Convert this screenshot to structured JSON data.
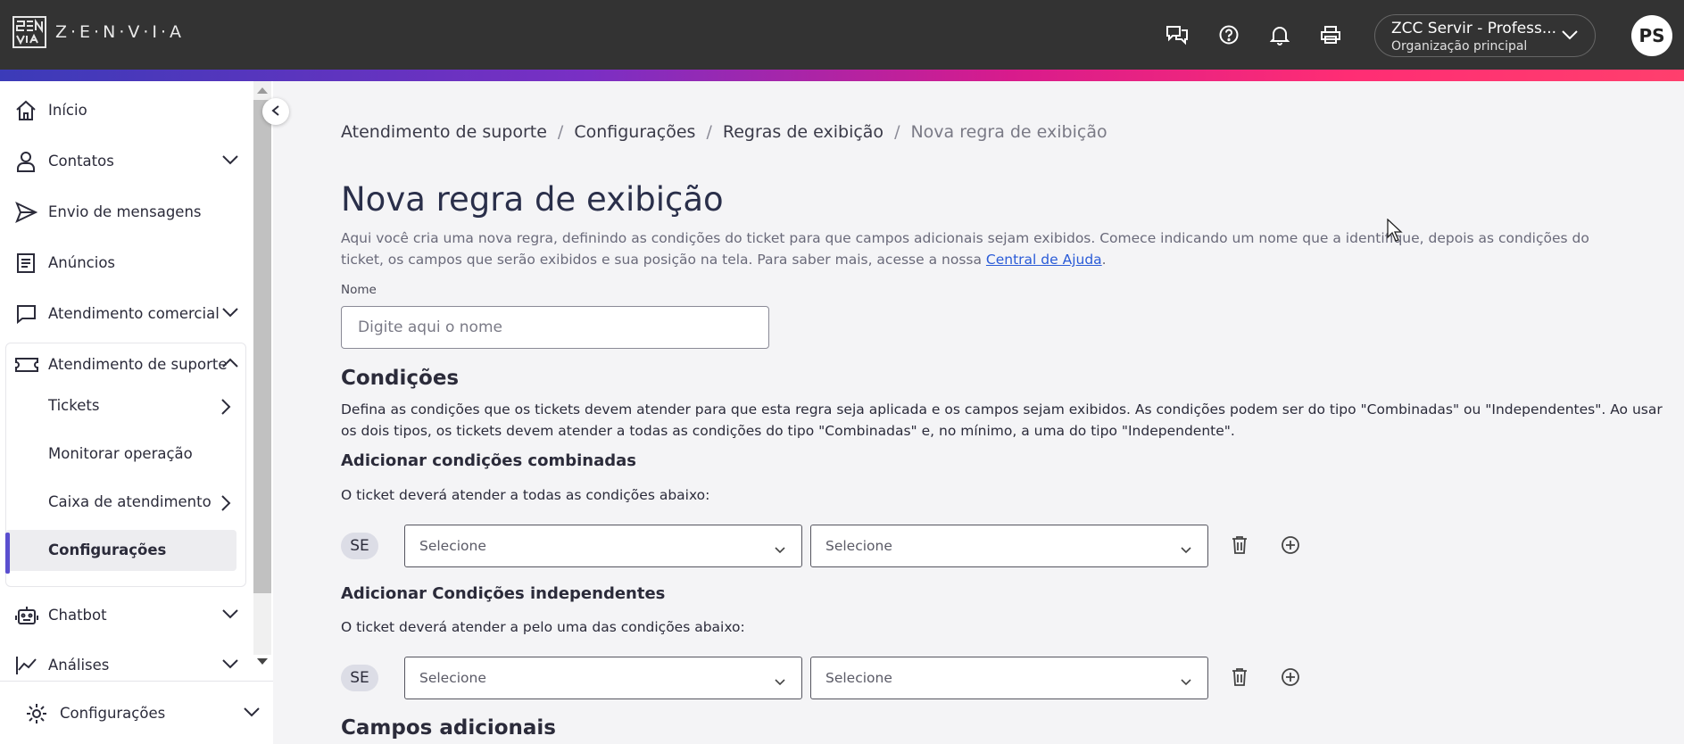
{
  "header": {
    "brand": "Z·E·N·V·I·A",
    "org_name": "ZCC Servir - Profess...",
    "org_sub": "Organização principal",
    "avatar_initials": "PS"
  },
  "sidebar": {
    "items": [
      {
        "label": "Início"
      },
      {
        "label": "Contatos"
      },
      {
        "label": "Envio de mensagens"
      },
      {
        "label": "Anúncios"
      },
      {
        "label": "Atendimento comercial"
      },
      {
        "label": "Atendimento de suporte"
      },
      {
        "label": "Chatbot"
      },
      {
        "label": "Análises"
      }
    ],
    "sub_items": [
      {
        "label": "Tickets"
      },
      {
        "label": "Monitorar operação"
      },
      {
        "label": "Caixa de atendimento"
      },
      {
        "label": "Configurações"
      }
    ],
    "bottom": {
      "label": "Configurações"
    }
  },
  "breadcrumb": {
    "items": [
      "Atendimento de suporte",
      "Configurações",
      "Regras de exibição"
    ],
    "current": "Nova regra de exibição",
    "separator": "/"
  },
  "page": {
    "title": "Nova regra de exibição",
    "description": "Aqui você cria uma nova regra, definindo as condições do ticket para que campos adicionais sejam exibidos. Comece indicando um nome que a identifique, depois as condições do ticket, os campos que serão exibidos e sua posição na tela. Para saber mais, acesse a nossa ",
    "help_link": "Central de Ajuda",
    "description_end": "."
  },
  "form": {
    "name_label": "Nome",
    "name_placeholder": "Digite aqui o nome",
    "name_value": ""
  },
  "conditions": {
    "title": "Condições",
    "description": "Defina as condições que os tickets devem atender para que esta regra seja aplicada e os campos sejam exibidos. As condições podem ser do tipo \"Combinadas\" ou \"Independentes\". Ao usar os dois tipos, os tickets devem atender a todas as condições do tipo \"Combinadas\" e, no mínimo, a uma do tipo \"Independente\".",
    "combined": {
      "title": "Adicionar condições combinadas",
      "hint": "O ticket deverá atender a todas as condições abaixo:",
      "badge": "SE",
      "select1": "Selecione",
      "select2": "Selecione"
    },
    "independent": {
      "title": "Adicionar Condições independentes",
      "hint": "O ticket deverá atender a pelo uma das condições abaixo:",
      "badge": "SE",
      "select1": "Selecione",
      "select2": "Selecione"
    }
  },
  "additional_fields": {
    "title": "Campos adicionais"
  },
  "colors": {
    "topbar": "#333333",
    "accent": "#5a4fcf",
    "link": "#2a5bd7"
  }
}
